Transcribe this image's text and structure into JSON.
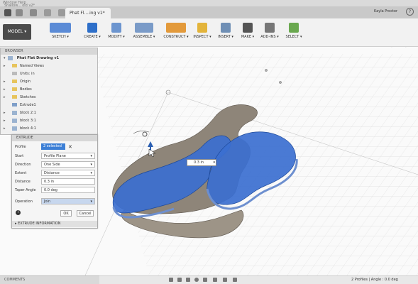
{
  "titlebar": {
    "text": "Window    Help"
  },
  "tabs": [
    {
      "label": "Shallow... old v2*"
    },
    {
      "label": "Phat Fl....ing v1*"
    }
  ],
  "user": {
    "name": "Kayla Proctor"
  },
  "toolbar": {
    "model": "MODEL",
    "groups": [
      "SKETCH",
      "CREATE",
      "MODIFY",
      "ASSEMBLE",
      "CONSTRUCT",
      "INSPECT",
      "INSERT",
      "MAKE",
      "ADD-INS",
      "SELECT"
    ]
  },
  "browser": {
    "title": "BROWSER",
    "root": "Phat Flat Drawing v1",
    "items": [
      "Named Views",
      "Units: in",
      "Origin",
      "Bodies",
      "Sketches",
      "Extrude1",
      "block 2:1",
      "block 3:1",
      "block 4:1"
    ]
  },
  "extrude": {
    "title": "EXTRUDE",
    "profile_label": "Profile",
    "profile_value": "2 selected",
    "start_label": "Start",
    "start_value": "Profile Plane",
    "direction_label": "Direction",
    "direction_value": "One Side",
    "extent_label": "Extent",
    "extent_value": "Distance",
    "distance_label": "Distance",
    "distance_value": "0.3 in",
    "taper_label": "Taper Angle",
    "taper_value": "0.0 deg",
    "operation_label": "Operation",
    "operation_value": "Join",
    "ok_label": "OK",
    "cancel_label": "Cancel",
    "info": "EXTRUDE INFORMATION"
  },
  "viewport": {
    "distance_input": "0.3 in"
  },
  "comments": {
    "label": "COMMENTS"
  },
  "status": {
    "text": "2 Profiles | Angle : 0.0 deg"
  },
  "colors": {
    "accent": "#3c7fd6",
    "profile_blue": "#3b6fd0",
    "body_gray": "#8e8579"
  }
}
